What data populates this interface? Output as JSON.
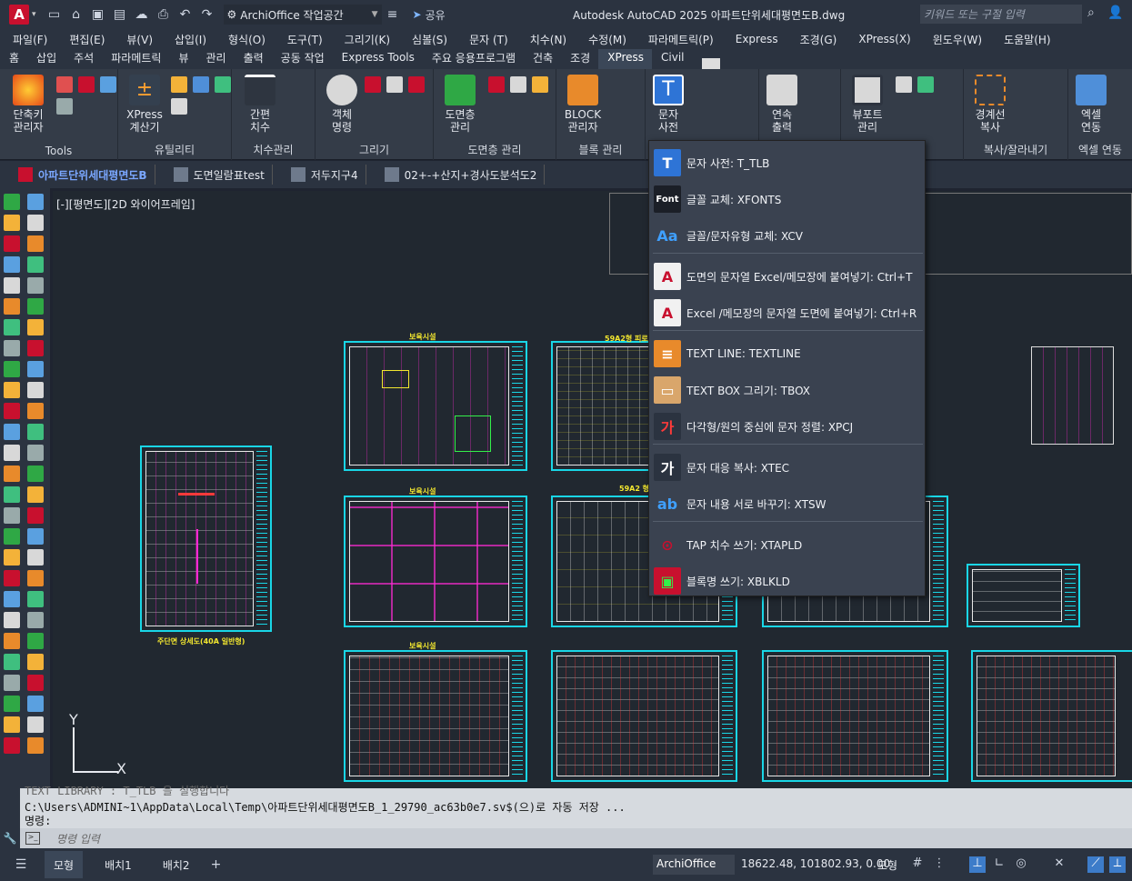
{
  "titlebar": {
    "logo": "A",
    "workspace": "ArchiOffice 작업공간",
    "share": "공유",
    "title": "Autodesk AutoCAD 2025    아파트단위세대평면도B.dwg",
    "search_placeholder": "키워드 또는 구절 입력"
  },
  "menubar": [
    "파일(F)",
    "편집(E)",
    "뷰(V)",
    "삽입(I)",
    "형식(O)",
    "도구(T)",
    "그리기(K)",
    "심볼(S)",
    "문자 (T)",
    "치수(N)",
    "수정(M)",
    "파라메트릭(P)",
    "Express",
    "조경(G)",
    "XPress(X)",
    "윈도우(W)",
    "도움말(H)"
  ],
  "ribbon_tabs": [
    "홈",
    "삽입",
    "주석",
    "파라메트릭",
    "뷰",
    "관리",
    "출력",
    "공동 작업",
    "Express Tools",
    "주요 응용프로그램",
    "건축",
    "조경",
    "XPress",
    "Civil"
  ],
  "ribbon_active_tab": "XPress",
  "ribbon": {
    "panels": [
      {
        "title": "Tools",
        "big_label": "단축키\n관리자"
      },
      {
        "title": "유틸리티",
        "big_label": "XPress\n계산기"
      },
      {
        "title": "치수관리",
        "big_label": "간편\n치수"
      },
      {
        "title": "그리기",
        "big_label": "객체\n명령"
      },
      {
        "title": "도면층 관리",
        "big_label": "도면층\n관리"
      },
      {
        "title": "블록 관리",
        "big_label": "BLOCK\n관리자"
      },
      {
        "title": "",
        "big_label": "문자\n사전"
      },
      {
        "title": "",
        "big_label": "연속\n출력"
      },
      {
        "title": "",
        "big_label": "뷰포트\n관리"
      },
      {
        "title": "복사/잘라내기",
        "big_label": "경계선\n복사"
      },
      {
        "title": "엑셀 연동",
        "big_label": "엑셀\n연동"
      }
    ]
  },
  "doc_tabs": [
    "아파트단위세대평면도B",
    "도면일람표test",
    "저두지구4",
    "02+-+산지+경사도분석도2"
  ],
  "viewport_label": "[-][평면도][2D 와이어프레임]",
  "sheets": {
    "title_a": "보육시설",
    "title_b": "59A2형 피로",
    "title_c": "보육시설",
    "title_d": "59A2 형",
    "title_e": "보육시설",
    "left_caption": "주단면 상세도(40A 일반형)"
  },
  "ucs": {
    "x": "X",
    "y": "Y"
  },
  "dropdown": {
    "items": [
      {
        "label": "문자 사전: T_TLB",
        "icon": "text-dictionary-icon"
      },
      {
        "label": "글꼴 교체: XFONTS",
        "icon": "font-replace-icon"
      },
      {
        "label": "글꼴/문자유형 교체: XCV",
        "icon": "text-style-replace-icon"
      },
      {
        "label": "도면의 문자열 Excel/메모장에 붙여넣기: Ctrl+T",
        "icon": "text-to-excel-icon"
      },
      {
        "label": "Excel /메모장의 문자열 도면에 붙여넣기: Ctrl+R",
        "icon": "excel-to-text-icon"
      },
      {
        "label": "TEXT LINE: TEXTLINE",
        "icon": "text-line-icon"
      },
      {
        "label": "TEXT BOX 그리기: TBOX",
        "icon": "text-box-icon"
      },
      {
        "label": "다각형/원의 중심에 문자 정렬: XPCJ",
        "icon": "center-align-text-icon"
      },
      {
        "label": "문자 대응 복사: XTEC",
        "icon": "text-copy-icon"
      },
      {
        "label": "문자 내용 서로 바꾸기: XTSW",
        "icon": "text-swap-icon"
      },
      {
        "label": "TAP 치수 쓰기: XTAPLD",
        "icon": "tap-dimension-icon"
      },
      {
        "label": "블록명 쓰기: XBLKLD",
        "icon": "block-name-icon"
      }
    ],
    "font_icon_text": "Font"
  },
  "command": {
    "history_1": "TEXT LIBRARY : T_TLB 을 실행합니다",
    "history_2": "C:\\Users\\ADMINI~1\\AppData\\Local\\Temp\\아파트단위세대평면도B_1_29790_ac63b0e7.sv$(으)로 자동 저장 ...",
    "history_3": "명령:",
    "placeholder": "명령 입력"
  },
  "statusbar": {
    "layouts": [
      "모형",
      "배치1",
      "배치2"
    ],
    "app_name": "ArchiOffice",
    "coords": "18622.48, 101802.93, 0.00",
    "model": "모형"
  }
}
